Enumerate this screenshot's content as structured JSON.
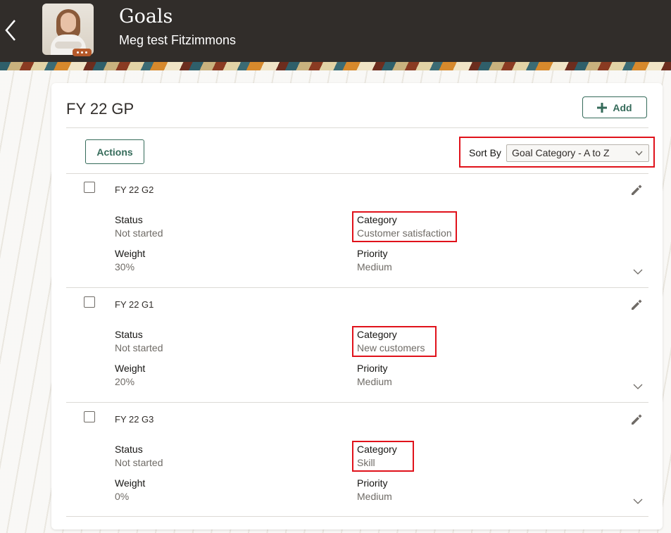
{
  "header": {
    "title": "Goals",
    "subtitle": "Meg test Fitzimmons"
  },
  "card": {
    "title": "FY 22 GP",
    "add_label": "Add",
    "actions_label": "Actions",
    "sort_label": "Sort By",
    "sort_value": "Goal Category - A to Z"
  },
  "labels": {
    "status": "Status",
    "category": "Category",
    "weight": "Weight",
    "priority": "Priority"
  },
  "goals": [
    {
      "name": "FY 22 G2",
      "status": "Not started",
      "category": "Customer satisfaction",
      "weight": "30%",
      "priority": "Medium"
    },
    {
      "name": "FY 22 G1",
      "status": "Not started",
      "category": "New customers",
      "weight": "20%",
      "priority": "Medium"
    },
    {
      "name": "FY 22 G3",
      "status": "Not started",
      "category": "Skill",
      "weight": "0%",
      "priority": "Medium"
    }
  ],
  "colors": {
    "accent": "#356b5a",
    "highlight": "#e0121b",
    "header_bg": "#312d2a"
  }
}
